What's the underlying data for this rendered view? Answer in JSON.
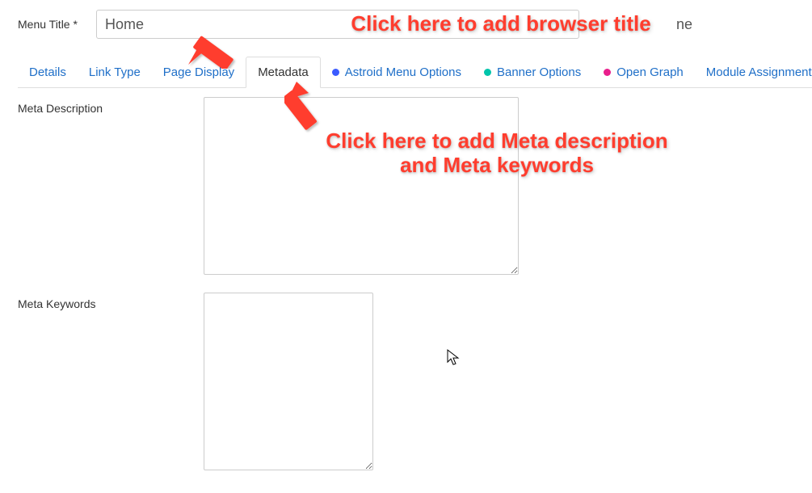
{
  "topField": {
    "label": "Menu Title *",
    "value": "Home"
  },
  "rightHint": "ne",
  "tabs": {
    "items": [
      {
        "label": "Details"
      },
      {
        "label": "Link Type"
      },
      {
        "label": "Page Display"
      },
      {
        "label": "Metadata"
      },
      {
        "label": "Astroid Menu Options"
      },
      {
        "label": "Banner Options"
      },
      {
        "label": "Open Graph"
      },
      {
        "label": "Module Assignment"
      }
    ],
    "activeIndex": 3
  },
  "form": {
    "metaDescriptionLabel": "Meta Description",
    "metaDescriptionValue": "",
    "metaKeywordsLabel": "Meta Keywords",
    "metaKeywordsValue": ""
  },
  "annotations": {
    "a1": "Click here to add browser title",
    "a2_line1": "Click here to add Meta description",
    "a2_line2": "and Meta keywords"
  },
  "colors": {
    "link": "#1f6fc8",
    "annotation": "#ff3d2e",
    "dotBlue": "#3b5bff",
    "dotTeal": "#00c5ab",
    "dotPink": "#e91e8c"
  }
}
